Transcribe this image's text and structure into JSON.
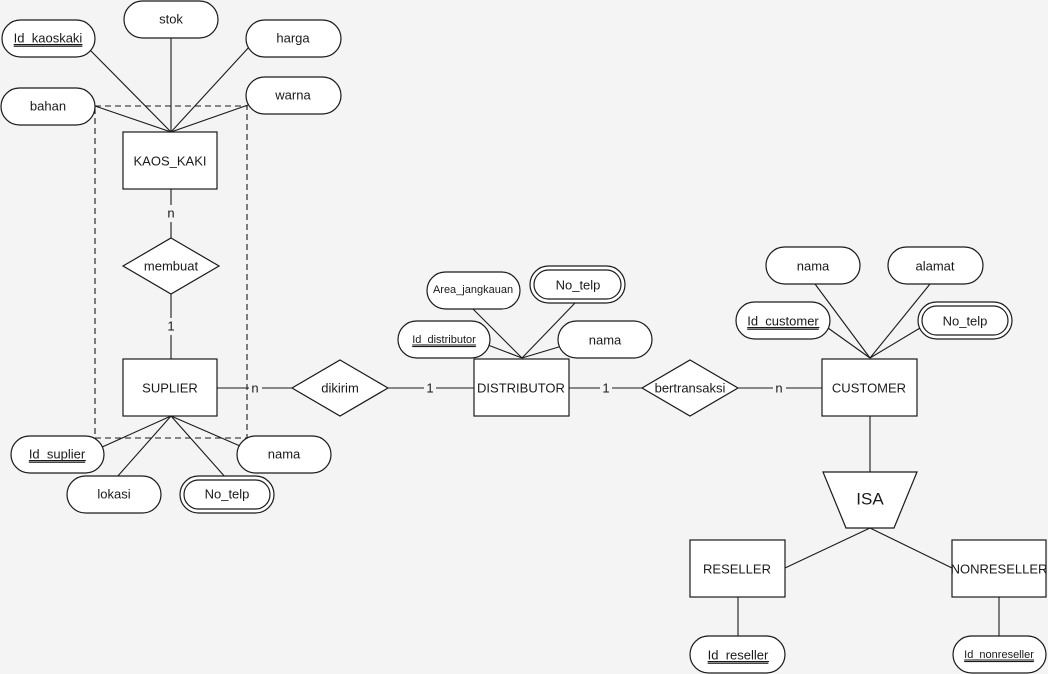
{
  "entities": {
    "kaos_kaki": "KAOS_KAKI",
    "suplier": "SUPLIER",
    "distributor": "DISTRIBUTOR",
    "customer": "CUSTOMER",
    "reseller": "RESELLER",
    "nonreseller": "NONRESELLER"
  },
  "relationships": {
    "membuat": "membuat",
    "dikirim": "dikirim",
    "bertransaksi": "bertransaksi",
    "isa": "ISA"
  },
  "cardinalities": {
    "kaos_membuat": "n",
    "membuat_suplier": "1",
    "suplier_dikirim": "n",
    "dikirim_distributor": "1",
    "distributor_bertransaksi": "1",
    "bertransaksi_customer": "n"
  },
  "attributes": {
    "kaos_kaki": {
      "id": "Id_kaoskaki",
      "stok": "stok",
      "harga": "harga",
      "bahan": "bahan",
      "warna": "warna"
    },
    "suplier": {
      "id": "Id_suplier",
      "lokasi": "lokasi",
      "no_telp": "No_telp",
      "nama": "nama"
    },
    "distributor": {
      "id": "Id_distributor",
      "area": "Area_jangkauan",
      "no_telp": "No_telp",
      "nama": "nama"
    },
    "customer": {
      "id": "Id_customer",
      "nama": "nama",
      "alamat": "alamat",
      "no_telp": "No_telp"
    },
    "reseller": {
      "id": "Id_reseller"
    },
    "nonreseller": {
      "id": "Id_nonreseller"
    }
  }
}
